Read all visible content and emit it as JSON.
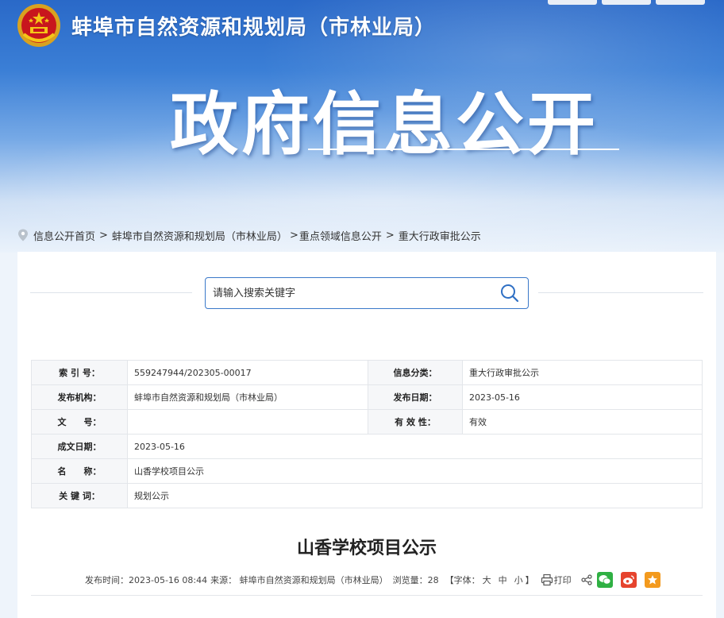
{
  "header": {
    "org_title": "蚌埠市自然资源和规划局（市林业局）",
    "big_title": "政府信息公开"
  },
  "breadcrumb": {
    "items": [
      "信息公开首页",
      "蚌埠市自然资源和规划局（市林业局）",
      "重点领域信息公开",
      "重大行政审批公示"
    ],
    "sep1": ">",
    "sep2": ">",
    "sep3": ">"
  },
  "search": {
    "placeholder": "请输入搜索关键字"
  },
  "info": {
    "index_label": "索 引 号：",
    "index_value": "559247944/202305-00017",
    "category_label": "信息分类：",
    "category_value": "重大行政审批公示",
    "publisher_label": "发布机构：",
    "publisher_value": "蚌埠市自然资源和规划局（市林业局）",
    "pubdate_label": "发布日期：",
    "pubdate_value": "2023-05-16",
    "docno_label": "文　　号：",
    "docno_value": "",
    "validity_label": "有 效 性：",
    "validity_value": "有效",
    "writedate_label": "成文日期：",
    "writedate_value": "2023-05-16",
    "name_label": "名　　称：",
    "name_value": "山香学校项目公示",
    "keywords_label": "关 键 词：",
    "keywords_value": "规划公示"
  },
  "article": {
    "title": "山香学校项目公示",
    "publish_time": "发布时间：2023-05-16 08:44",
    "source": "来源：  蚌埠市自然资源和规划局（市林业局）",
    "views": "浏览量：28",
    "font_label": "【字体：",
    "font_large": "大",
    "font_medium": "中",
    "font_small": "小",
    "font_close": "】",
    "print_label": "打印"
  },
  "colors": {
    "accent": "#3a78c9",
    "wechat": "#2fb043",
    "weibo": "#e6442e",
    "favorite": "#f39a1e"
  },
  "icons": [
    "location-pin-icon",
    "search-icon",
    "printer-icon",
    "share-icon",
    "wechat-icon",
    "weibo-icon",
    "favorite-icon"
  ]
}
